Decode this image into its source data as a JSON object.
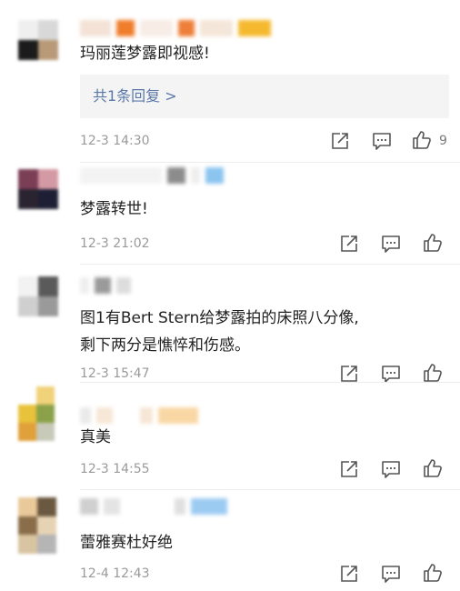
{
  "comments": [
    {
      "text_lines": [
        "玛丽莲梦露即视感!"
      ],
      "reply_label": "共1条回复 >",
      "time": "12-3 14:30",
      "like_count": "9"
    },
    {
      "text_lines": [
        "梦露转世!"
      ],
      "time": "12-3 21:02"
    },
    {
      "text_lines": [
        "图1有Bert Stern给梦露拍的床照八分像,",
        "剩下两分是憔悴和伤感。"
      ],
      "time": "12-3 15:47"
    },
    {
      "text_lines": [
        "真美"
      ],
      "time": "12-3 14:55"
    },
    {
      "text_lines": [
        "蕾雅赛杜好绝"
      ],
      "time": "12-4 12:43"
    }
  ],
  "icons": {
    "share": "share-icon",
    "comment": "comment-icon",
    "like": "thumbs-up-icon"
  },
  "colors": {
    "text": "#222222",
    "meta": "#9a9a9a",
    "reply_link": "#5a78a8",
    "reply_bg": "#f4f4f4",
    "icon_stroke": "#555555"
  }
}
